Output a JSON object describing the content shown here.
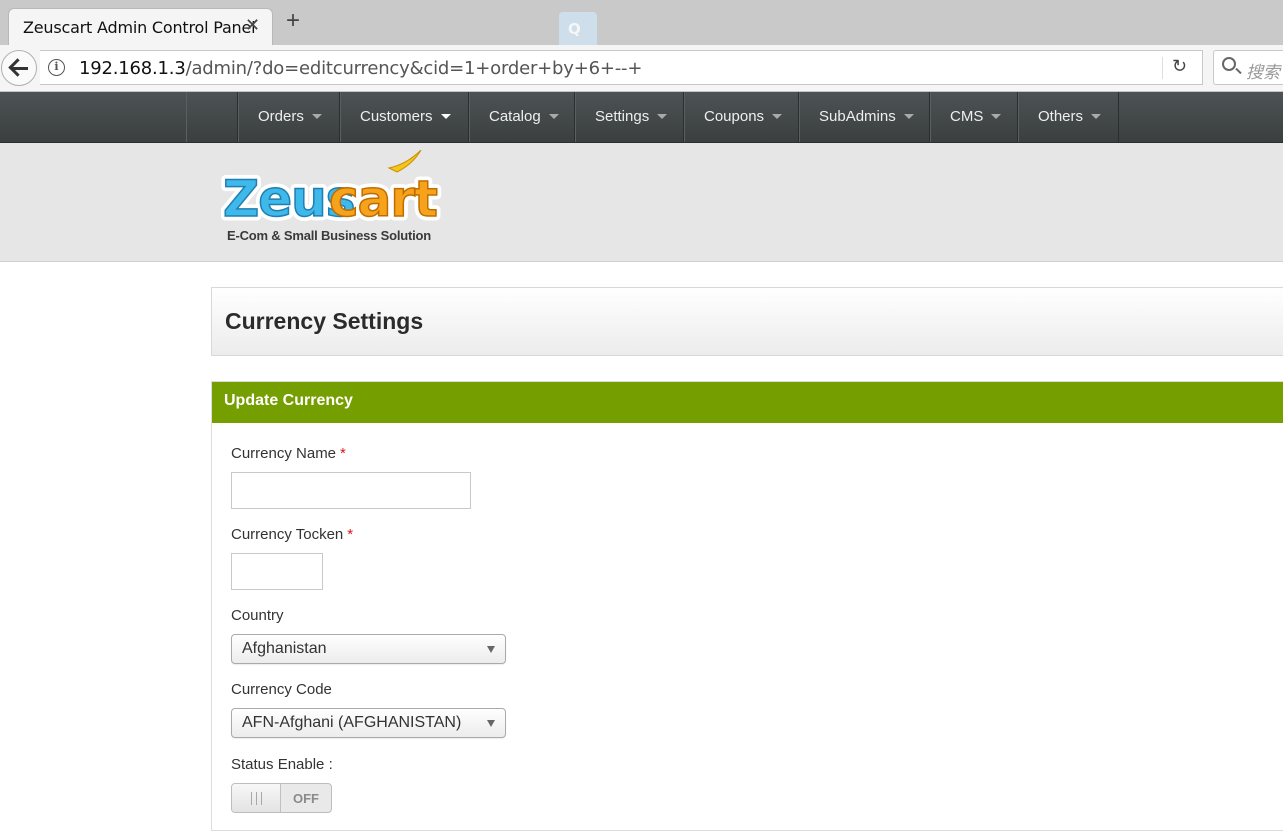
{
  "browser": {
    "tab_title": "Zeuscart Admin Control Panel",
    "tab_close": "✕",
    "new_tab": "+",
    "url_host": "192.168.1.3",
    "url_path": "/admin/?do=editcurrency&cid=1+order+by+6+--+",
    "search_placeholder": "搜索",
    "extension_badge": "Q"
  },
  "navbar": {
    "items": [
      {
        "label": "Orders"
      },
      {
        "label": "Customers"
      },
      {
        "label": "Catalog"
      },
      {
        "label": "Settings"
      },
      {
        "label": "Coupons"
      },
      {
        "label": "SubAdmins"
      },
      {
        "label": "CMS"
      },
      {
        "label": "Others"
      }
    ]
  },
  "logo": {
    "part1": "Zeus",
    "part2": "cart",
    "tagline": "E-Com & Small Business Solution"
  },
  "page": {
    "title": "Currency Settings"
  },
  "form": {
    "header": "Update Currency",
    "required_mark": "*",
    "currency_name_label": "Currency Name",
    "currency_name_value": "",
    "currency_token_label": "Currency Tocken",
    "currency_token_value": "",
    "country_label": "Country",
    "country_value": "Afghanistan",
    "currency_code_label": "Currency Code",
    "currency_code_value": "AFN-Afghani (AFGHANISTAN)",
    "status_label": "Status Enable :",
    "status_state": "OFF"
  },
  "colors": {
    "navbar": "#43494a",
    "panel_header": "#759e00",
    "required": "#d9141a",
    "logo_blue": "#3fb8ea",
    "logo_orange": "#f6a21b"
  }
}
